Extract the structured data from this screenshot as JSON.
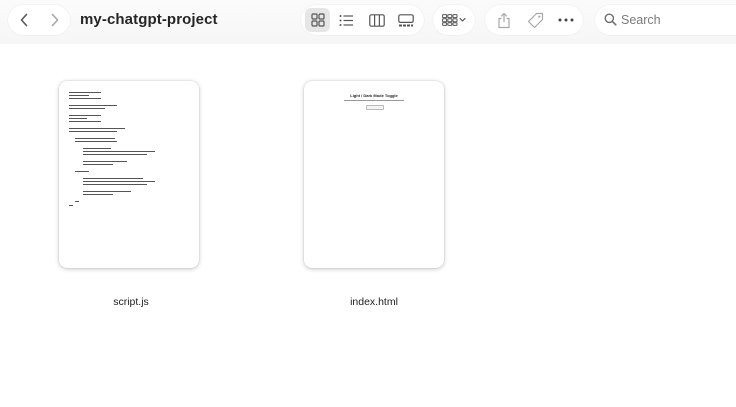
{
  "window": {
    "title": "my-chatgpt-project"
  },
  "toolbar": {
    "back_icon": "chevron-left-icon",
    "forward_icon": "chevron-right-icon",
    "view_modes": [
      "icon-view",
      "list-view",
      "column-view",
      "gallery-view"
    ],
    "active_view": "icon-view",
    "group_icon": "group-by-icon",
    "share_icon": "share-icon",
    "tag_icon": "tag-icon",
    "more_icon": "more-icon"
  },
  "search": {
    "placeholder": "Search"
  },
  "files": [
    {
      "name": "script.js",
      "kind": "code"
    },
    {
      "name": "index.html",
      "kind": "html"
    }
  ],
  "colors": {
    "toolbar_bg": "#f7f7f7",
    "active_view_bg": "#e6e6e6",
    "icon_gray": "#6e6e6e"
  }
}
